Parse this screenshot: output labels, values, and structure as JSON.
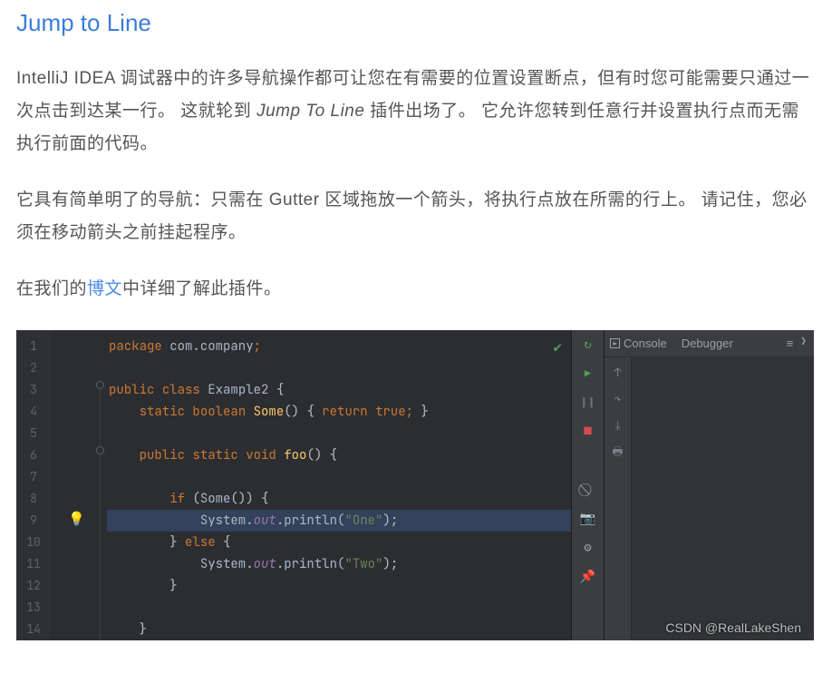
{
  "title": "Jump to Line",
  "para1_a": "IntelliJ IDEA 调试器中的许多导航操作都可让您在有需要的位置设置断点，但有时您可能需要只通过一次点击到达某一行。 这就轮到 ",
  "para1_italic": "Jump To Line",
  "para1_b": " 插件出场了。 它允许您转到任意行并设置执行点而无需执行前面的代码。",
  "para2": "它具有简单明了的导航：只需在 Gutter 区域拖放一个箭头，将执行点放在所需的行上。 请记住，您必须在移动箭头之前挂起程序。",
  "para3_a": "在我们的",
  "para3_link": "博文",
  "para3_b": "中详细了解此插件。",
  "line_numbers": [
    "1",
    "2",
    "3",
    "4",
    "5",
    "6",
    "7",
    "8",
    "9",
    "10",
    "11",
    "12",
    "13",
    "14"
  ],
  "code": {
    "l1_package": "package",
    "l1_pkg": " com.company",
    "l1_semi": ";",
    "l3_public": "public ",
    "l3_class": "class ",
    "l3_name": "Example2",
    "l3_brace": " {",
    "l4": "    static boolean Some() { return true; }",
    "l4_static": "static ",
    "l4_boolean": "boolean ",
    "l4_some": "Some",
    "l4_paren": "()",
    "l4_brace1": " { ",
    "l4_return": "return ",
    "l4_true": "true",
    "l4_semi": ";",
    "l4_brace2": " }",
    "l6_public": "public ",
    "l6_static": "static ",
    "l6_void": "void ",
    "l6_foo": "foo",
    "l6_paren": "()",
    "l6_brace": " {",
    "l8_if": "if ",
    "l8_cond_open": "(",
    "l8_some": "Some",
    "l8_cond_close": "())",
    "l8_brace": " {",
    "l9_sys": "System.",
    "l9_out": "out",
    "l9_println": ".println(",
    "l9_str": "\"One\"",
    "l9_close": ");",
    "l10_else_close": "} ",
    "l10_else": "else",
    "l10_brace": " {",
    "l11_sys": "System.",
    "l11_out": "out",
    "l11_println": ".println(",
    "l11_str": "\"Two\"",
    "l11_close": ");",
    "l12_brace": "}",
    "l14_brace": "}"
  },
  "tabs": {
    "console": "Console",
    "debugger": "Debugger"
  },
  "watermark": "CSDN @RealLakeShen"
}
